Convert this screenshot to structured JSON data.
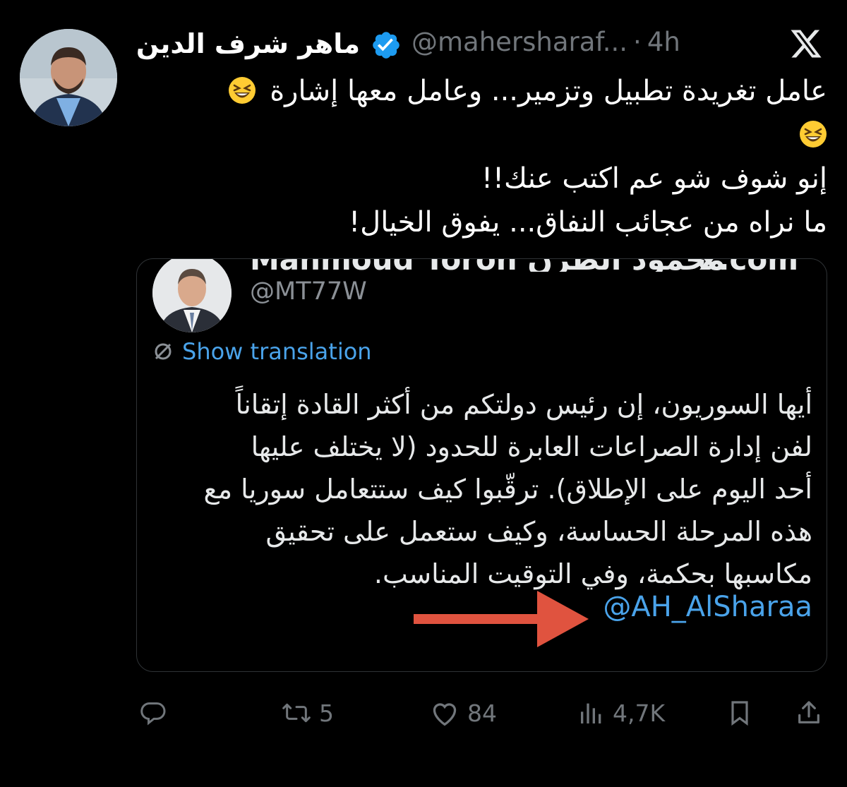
{
  "tweet": {
    "author_name": "ماهر شرف الدين",
    "handle": "@mahersharaf...",
    "separator": "·",
    "time": "4h",
    "lines": [
      "عامل تغريدة تطبيل وتزمير... وعامل معها إشارة",
      "",
      "إنو شوف شو عم اكتب عنك!!",
      "ما نراه من عجائب النفاق... يفوق الخيال!"
    ],
    "emoji_name": "grinning-squinting-face"
  },
  "quoted": {
    "clipped_top_text": "Mahmoud Toron محمود الطرن",
    "clipped_url_text": "x.com",
    "handle": "@MT77W",
    "translate_label": "Show translation",
    "lines": [
      "أيها السوريون، إن رئيس دولتكم من أكثر القادة إتقاناً",
      "لفن إدارة الصراعات العابرة للحدود (لا يختلف عليها",
      "أحد اليوم على الإطلاق). ترقّبوا كيف ستتعامل سوريا مع",
      "هذه المرحلة الحساسة، وكيف ستعمل على تحقيق",
      "مكاسبها بحكمة، وفي التوقيت المناسب."
    ],
    "mention": "@AH_AlSharaa",
    "arrow_color": "#e0533f"
  },
  "actions": {
    "reply_count": "",
    "retweet_count": "5",
    "like_count": "84",
    "views_count": "4,7K"
  },
  "colors": {
    "background": "#000000",
    "text": "#e7e9ea",
    "muted": "#71767b",
    "link": "#4aa3ea",
    "verified": "#1d9bf0"
  }
}
